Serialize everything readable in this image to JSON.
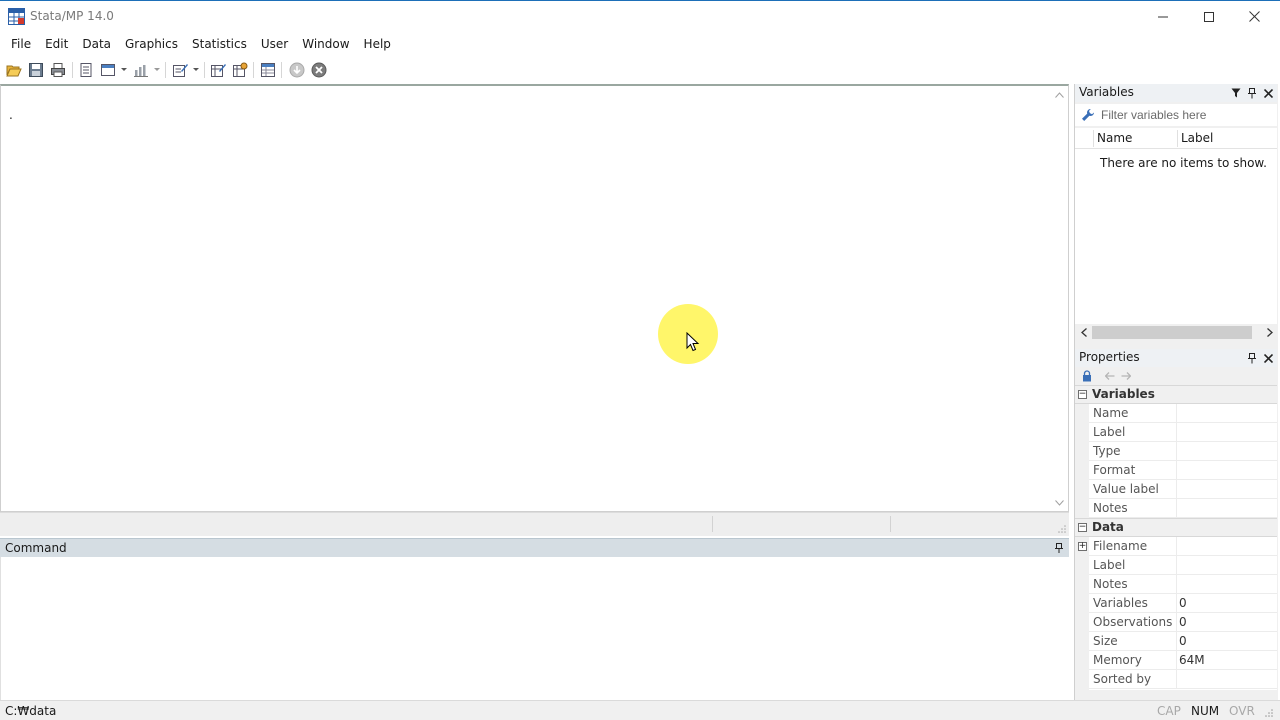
{
  "window": {
    "title": "Stata/MP 14.0"
  },
  "menu": [
    "File",
    "Edit",
    "Data",
    "Graphics",
    "Statistics",
    "User",
    "Window",
    "Help"
  ],
  "toolbar": {
    "icons": [
      "open-icon",
      "save-icon",
      "print-icon",
      "log-icon",
      "viewer-icon",
      "graph-icon",
      "do-file-editor-icon",
      "data-editor-icon",
      "data-browser-icon",
      "variables-manager-icon",
      "more-icon",
      "break-icon"
    ]
  },
  "results": {
    "prompt": "."
  },
  "command": {
    "title": "Command"
  },
  "variables": {
    "title": "Variables",
    "filter_placeholder": "Filter variables here",
    "columns": [
      "Name",
      "Label"
    ],
    "empty_message": "There are no items to show."
  },
  "properties": {
    "title": "Properties",
    "sections": [
      {
        "title": "Variables",
        "rows": [
          {
            "name": "Name",
            "value": ""
          },
          {
            "name": "Label",
            "value": ""
          },
          {
            "name": "Type",
            "value": ""
          },
          {
            "name": "Format",
            "value": ""
          },
          {
            "name": "Value label",
            "value": ""
          },
          {
            "name": "Notes",
            "value": ""
          }
        ]
      },
      {
        "title": "Data",
        "rows": [
          {
            "name": "Filename",
            "value": ""
          },
          {
            "name": "Label",
            "value": ""
          },
          {
            "name": "Notes",
            "value": ""
          },
          {
            "name": "Variables",
            "value": "0"
          },
          {
            "name": "Observations",
            "value": "0"
          },
          {
            "name": "Size",
            "value": "0"
          },
          {
            "name": "Memory",
            "value": "64M"
          },
          {
            "name": "Sorted by",
            "value": ""
          }
        ]
      }
    ]
  },
  "statusbar": {
    "path": "C:₩data",
    "indicators": {
      "cap": "CAP",
      "num": "NUM",
      "ovr": "OVR"
    }
  },
  "colors": {
    "accent": "#1d6fb8",
    "command_header": "#d5dde3",
    "cursor_highlight": "#fff550"
  }
}
